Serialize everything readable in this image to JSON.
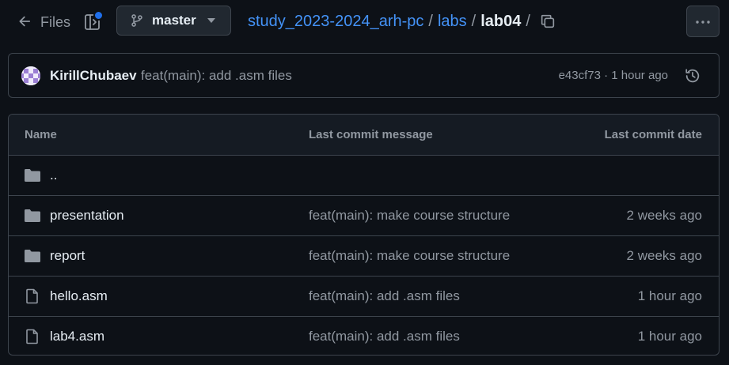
{
  "topbar": {
    "files_label": "Files",
    "branch": "master",
    "breadcrumbs": [
      {
        "label": "study_2023-2024_arh-pc"
      },
      {
        "label": "labs"
      },
      {
        "label": "lab04"
      }
    ],
    "separator": "/"
  },
  "commit": {
    "author": "KirillChubaev",
    "message": "feat(main): add .asm files",
    "hash_time": "e43cf73 · 1 hour ago"
  },
  "table": {
    "headers": {
      "name": "Name",
      "message": "Last commit message",
      "date": "Last commit date"
    },
    "rows": [
      {
        "type": "folder",
        "name": "..",
        "message": "",
        "date": ""
      },
      {
        "type": "folder",
        "name": "presentation",
        "message": "feat(main): make course structure",
        "date": "2 weeks ago"
      },
      {
        "type": "folder",
        "name": "report",
        "message": "feat(main): make course structure",
        "date": "2 weeks ago"
      },
      {
        "type": "file",
        "name": "hello.asm",
        "message": "feat(main): add .asm files",
        "date": "1 hour ago"
      },
      {
        "type": "file",
        "name": "lab4.asm",
        "message": "feat(main): add .asm files",
        "date": "1 hour ago"
      }
    ]
  },
  "colors": {
    "background": "#0d1117",
    "link": "#4493f8",
    "muted": "#9198a1",
    "border": "#3d444d",
    "accent_dot": "#1f6feb"
  },
  "icons": [
    "arrow-left-icon",
    "sidebar-panel-icon",
    "git-branch-icon",
    "caret-down-icon",
    "copy-icon",
    "kebab-menu-icon",
    "history-icon",
    "folder-icon",
    "file-icon"
  ]
}
